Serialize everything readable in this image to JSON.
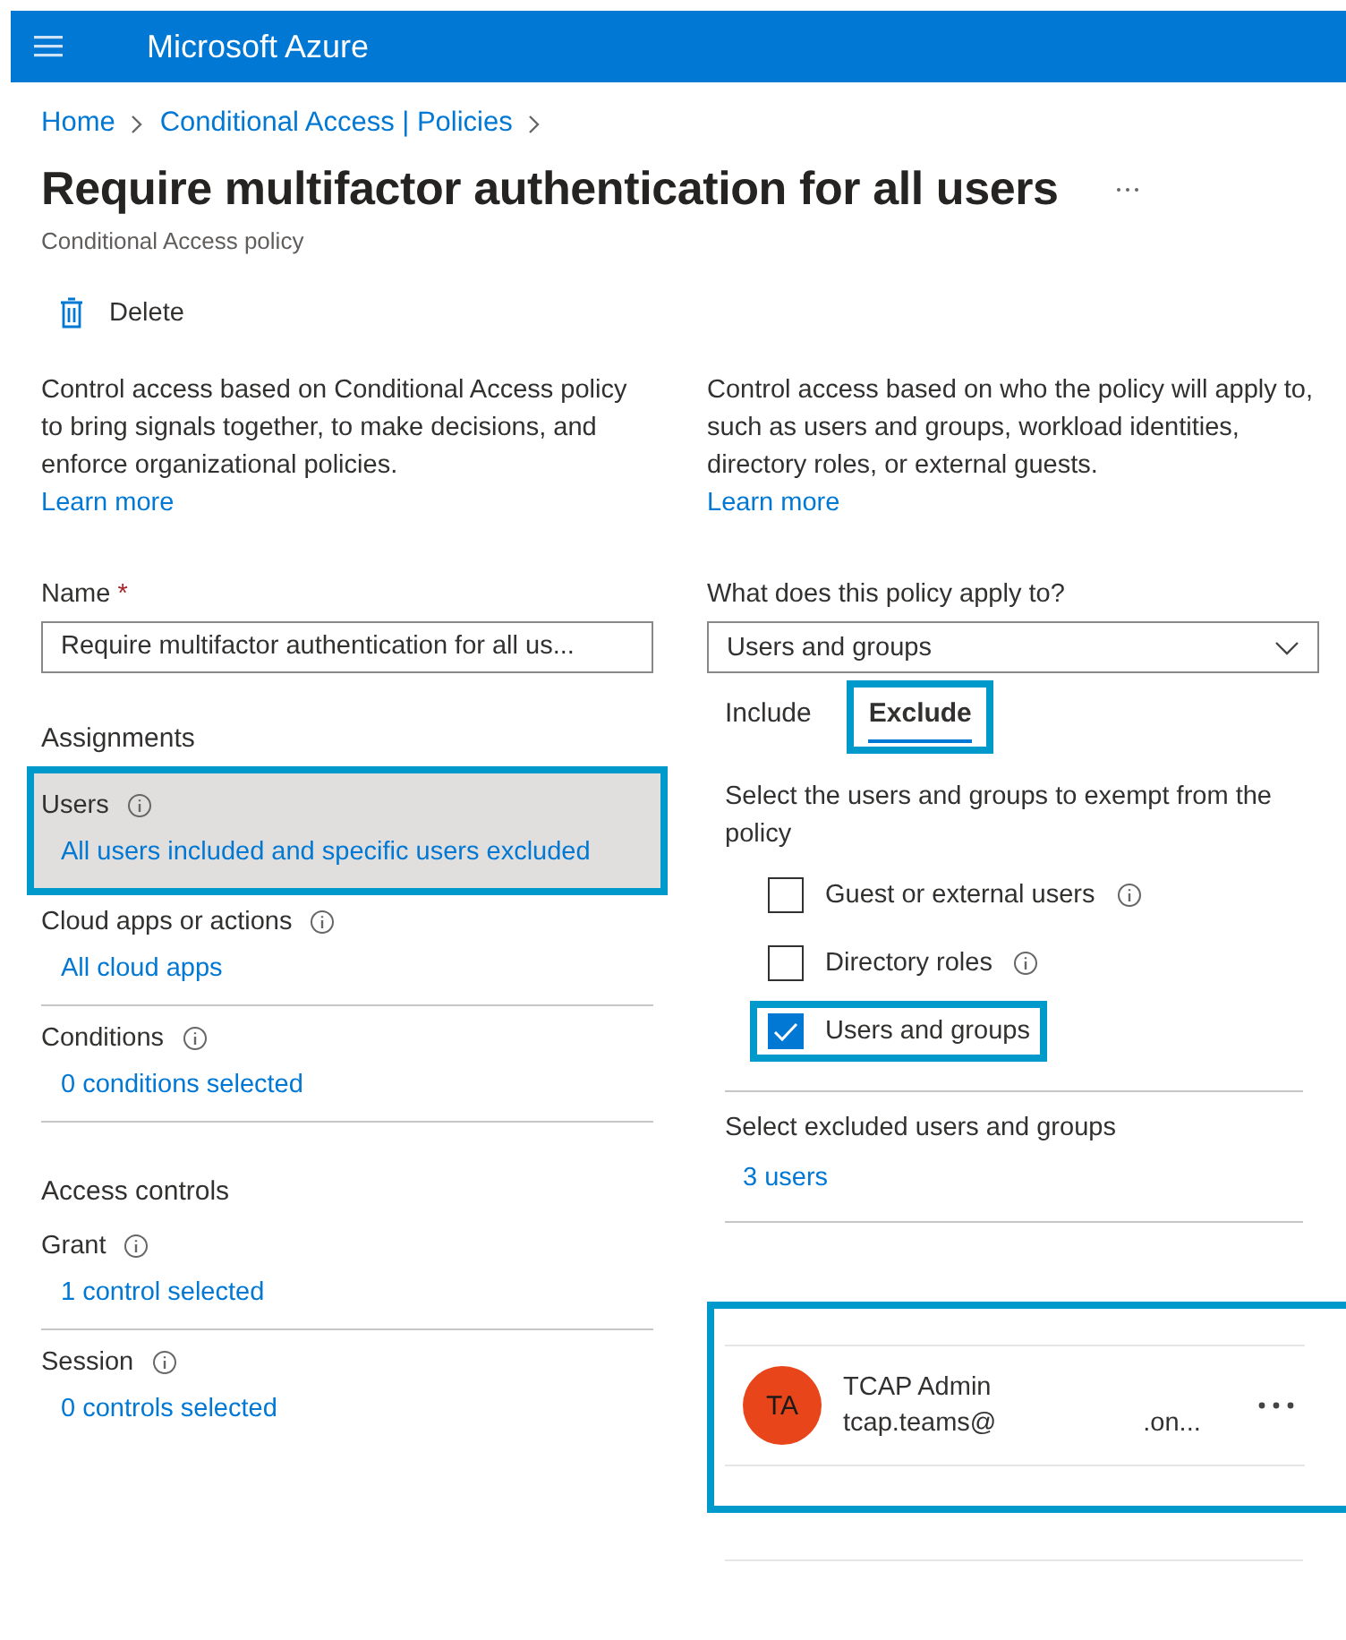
{
  "top_bar": {
    "title": "Microsoft Azure"
  },
  "breadcrumb": [
    "Home",
    "Conditional Access | Policies"
  ],
  "page": {
    "title": "Require multifactor authentication for all users",
    "subtitle": "Conditional Access policy"
  },
  "toolbar": {
    "delete": "Delete"
  },
  "left": {
    "description": "Control access based on Conditional Access policy to bring signals together, to make decisions, and enforce organizational policies.",
    "learn_more": "Learn more",
    "name_label": "Name",
    "required_mark": "*",
    "name_value": "Require multifactor authentication for all us...",
    "assignments_heading": "Assignments",
    "assignments": [
      {
        "label": "Users",
        "value": "All users included and specific users excluded",
        "highlighted": true
      },
      {
        "label": "Cloud apps or actions",
        "value": "All cloud apps",
        "highlighted": false
      },
      {
        "label": "Conditions",
        "value": "0 conditions selected",
        "highlighted": false
      }
    ],
    "access_heading": "Access controls",
    "access": [
      {
        "label": "Grant",
        "value": "1 control selected",
        "highlighted": false
      },
      {
        "label": "Session",
        "value": "0 controls selected",
        "highlighted": false
      }
    ]
  },
  "right": {
    "description": "Control access based on who the policy will apply to, such as users and groups, workload identities, directory roles, or external guests.",
    "learn_more": "Learn more",
    "applies_label": "What does this policy apply to?",
    "applies_value": "Users and groups",
    "tabs": [
      {
        "label": "Include",
        "selected": false,
        "highlighted": false
      },
      {
        "label": "Exclude",
        "selected": true,
        "highlighted": true
      }
    ],
    "exempt_text": "Select the users and groups to exempt from the policy",
    "options": [
      {
        "label": "Guest or external users",
        "checked": false,
        "info": true,
        "highlighted": false
      },
      {
        "label": "Directory roles",
        "checked": false,
        "info": true,
        "highlighted": false
      },
      {
        "label": "Users and groups",
        "checked": true,
        "info": false,
        "highlighted": true
      }
    ],
    "excluded_label": "Select excluded users and groups",
    "excluded_value": "3 users",
    "user": {
      "initials": "TA",
      "color": "#e8461a",
      "name": "TCAP Admin",
      "email_start": "tcap.teams@",
      "email_end": ".on...",
      "highlighted": true
    }
  }
}
